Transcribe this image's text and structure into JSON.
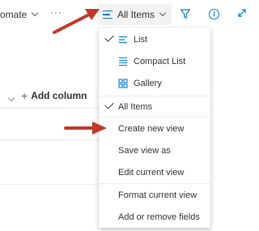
{
  "commandbar": {
    "automate_label": "omate",
    "more_label": "···",
    "view_selector_label": "All Items"
  },
  "column_header": {
    "add_column_label": "Add column",
    "plus_glyph": "+"
  },
  "view_menu": {
    "items": [
      {
        "label": "List",
        "checked": true,
        "icon": "list-icon"
      },
      {
        "label": "Compact List",
        "checked": false,
        "icon": "compact-list-icon"
      },
      {
        "label": "Gallery",
        "checked": false,
        "icon": "gallery-icon"
      },
      {
        "label": "All Items",
        "checked": true
      },
      {
        "label": "Create new view",
        "checked": false,
        "highlighted_by_arrow": true
      },
      {
        "label": "Save view as",
        "checked": false
      },
      {
        "label": "Edit current view",
        "checked": false
      },
      {
        "label": "Format current view",
        "checked": false
      },
      {
        "label": "Add or remove fields",
        "checked": false
      }
    ]
  },
  "colors": {
    "accent": "#0078d4",
    "annotation_arrow": "#c0392b",
    "text": "#323130"
  }
}
